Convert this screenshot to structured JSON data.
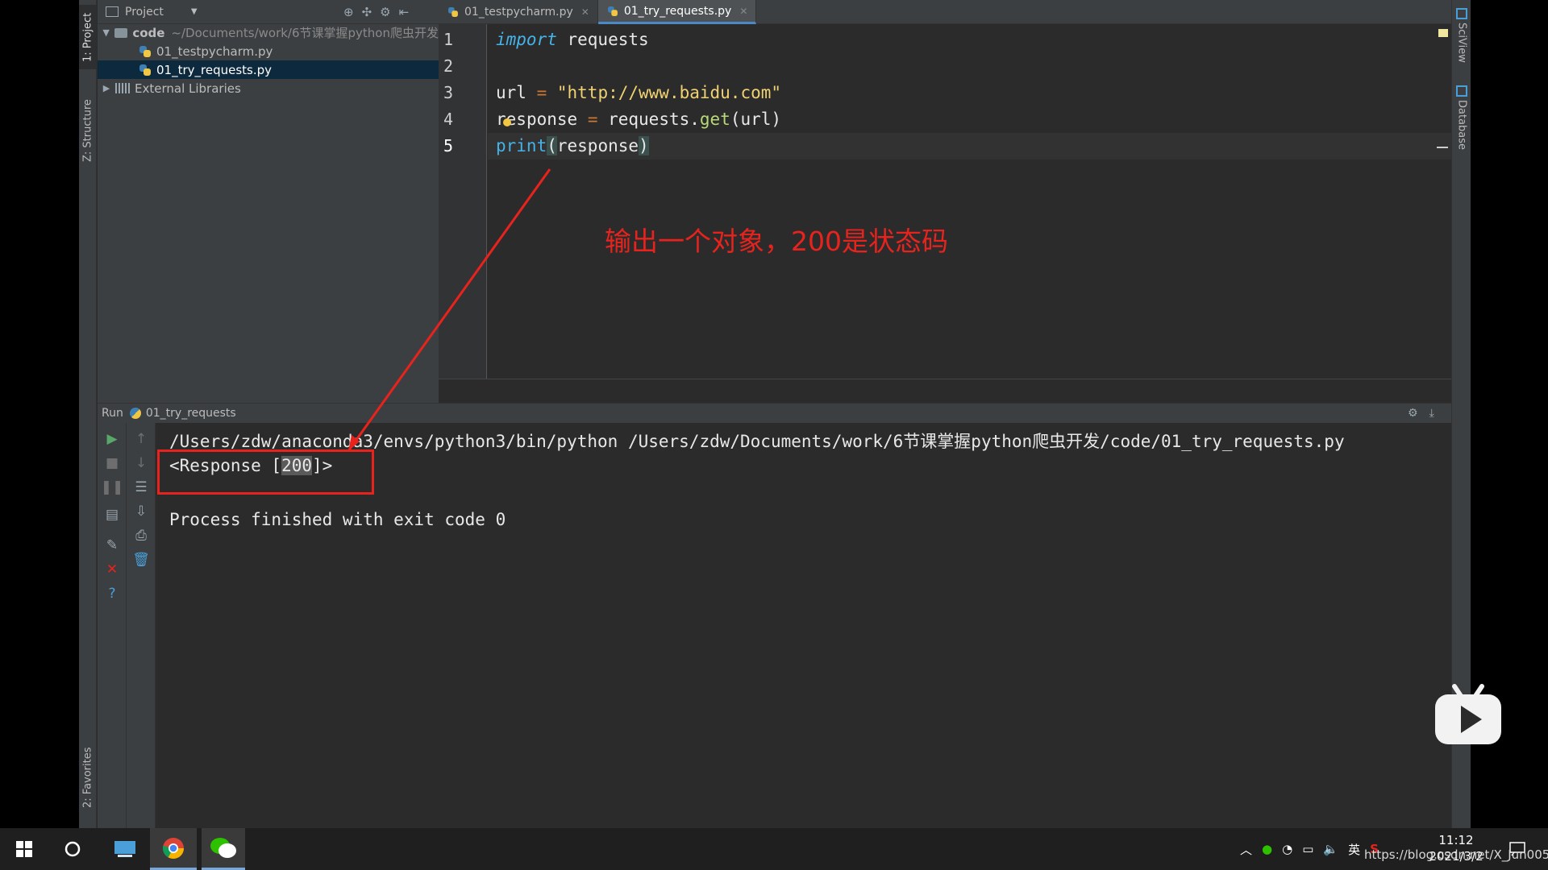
{
  "tool_windows": {
    "project_tab": "1: Project",
    "structure_tab": "Z: Structure",
    "favorites_tab": "2: Favorites",
    "sciview_tab": "SciView",
    "database_tab": "Database"
  },
  "project": {
    "header_label": "Project",
    "root_name": "code",
    "root_path": "~/Documents/work/6节课掌握python爬虫开发",
    "files": [
      "01_testpycharm.py",
      "01_try_requests.py"
    ],
    "selected_file": "01_try_requests.py",
    "external_libraries": "External Libraries"
  },
  "editor": {
    "tabs": [
      {
        "label": "01_testpycharm.py",
        "active": false
      },
      {
        "label": "01_try_requests.py",
        "active": true
      }
    ],
    "lines": [
      "1",
      "2",
      "3",
      "4",
      "5"
    ],
    "code": {
      "l1_kw": "import",
      "l1_rest": " requests",
      "l3_var": "url",
      "l3_op": " = ",
      "l3_str": "\"http://www.baidu.com\"",
      "l4_r": "r",
      "l4_rest": "esponse",
      "l4_op": " = ",
      "l4_obj": "requests.",
      "l4_fn": "get",
      "l4_args": "(url)",
      "l5_fn": "print",
      "l5_open": "(",
      "l5_arg": "response",
      "l5_close": ")"
    }
  },
  "run": {
    "label": "Run",
    "config": "01_try_requests",
    "console": {
      "command": "/Users/zdw/anaconda3/envs/python3/bin/python /Users/zdw/Documents/work/6节课掌握python爬虫开发/code/01_try_requests.py",
      "output_prefix": "<Response [",
      "output_code": "200",
      "output_suffix": "]>",
      "finish": "Process finished with exit code 0"
    }
  },
  "annotation": {
    "text": "输出一个对象，200是状态码",
    "color": "#e8231e"
  },
  "taskbar": {
    "tray_lang": "英",
    "time": "11:12",
    "date": "2021/3/2",
    "watermark": "https://blog.csdn.net/X_Jun005"
  },
  "colors": {
    "ide_bg": "#2b2b2b",
    "panel_bg": "#3c3f41",
    "selection": "#0d293e",
    "keyword": "#45b3e8",
    "string": "#f0d272",
    "function": "#b8d97a",
    "operator": "#cc7832"
  }
}
